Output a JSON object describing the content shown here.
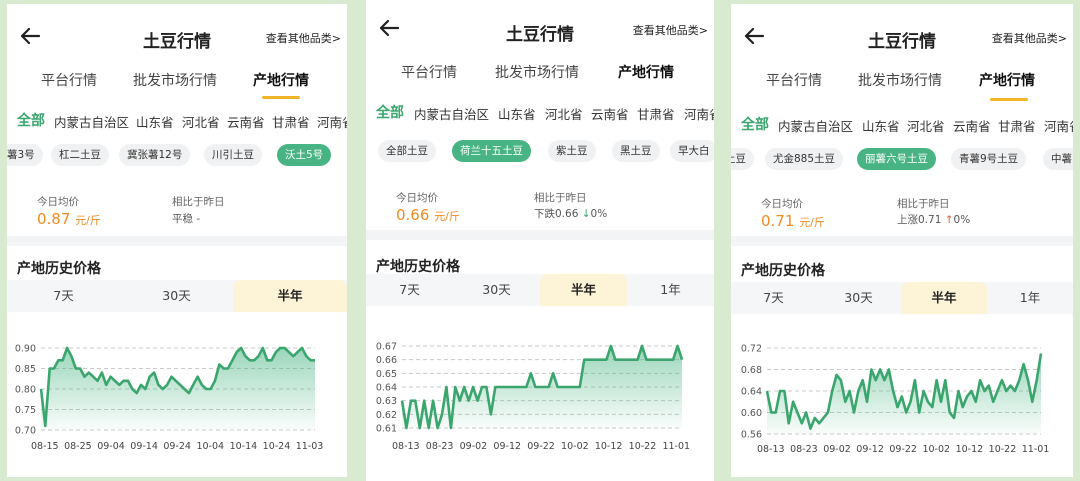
{
  "panels": [
    {
      "title": "土豆行情",
      "others_link": "查看其他品类>",
      "tabs": [
        "平台行情",
        "批发市场行情",
        "产地行情"
      ],
      "active_tab": 2,
      "regions": [
        "全部",
        "内蒙古自治区",
        "山东省",
        "河北省",
        "云南省",
        "甘肃省",
        "河南省"
      ],
      "active_region": 0,
      "varieties": [
        "薯3号",
        "杠二土豆",
        "冀张薯12号",
        "川引土豆",
        "沃土5号"
      ],
      "active_variety": 4,
      "price": {
        "today_label": "今日均价",
        "value": "0.87",
        "unit": "元/斤",
        "compare_label": "相比于昨日",
        "change_text": "平稳 -",
        "change_dir": "none"
      },
      "section_title": "产地历史价格",
      "ranges": [
        "7天",
        "30天",
        "半年"
      ],
      "active_range": 2,
      "chart_data": {
        "type": "area",
        "ylim": [
          0.7,
          0.9
        ],
        "yticks": [
          "0.70",
          "0.75",
          "0.80",
          "0.85",
          "0.90"
        ],
        "xticks": [
          "08-15",
          "08-25",
          "09-04",
          "09-14",
          "09-24",
          "10-04",
          "10-14",
          "10-24",
          "11-03"
        ],
        "values": [
          0.8,
          0.71,
          0.85,
          0.85,
          0.87,
          0.87,
          0.9,
          0.88,
          0.85,
          0.85,
          0.83,
          0.84,
          0.83,
          0.82,
          0.84,
          0.81,
          0.83,
          0.82,
          0.81,
          0.82,
          0.82,
          0.8,
          0.79,
          0.81,
          0.8,
          0.83,
          0.84,
          0.81,
          0.8,
          0.81,
          0.83,
          0.82,
          0.81,
          0.8,
          0.79,
          0.81,
          0.83,
          0.81,
          0.8,
          0.8,
          0.82,
          0.86,
          0.85,
          0.85,
          0.87,
          0.89,
          0.9,
          0.88,
          0.87,
          0.87,
          0.88,
          0.9,
          0.87,
          0.87,
          0.89,
          0.9,
          0.9,
          0.89,
          0.88,
          0.89,
          0.9,
          0.88,
          0.87,
          0.87
        ]
      }
    },
    {
      "title": "土豆行情",
      "others_link": "查看其他品类>",
      "tabs": [
        "平台行情",
        "批发市场行情",
        "产地行情"
      ],
      "active_tab": 2,
      "regions": [
        "全部",
        "内蒙古自治区",
        "山东省",
        "河北省",
        "云南省",
        "甘肃省",
        "河南省"
      ],
      "active_region": 0,
      "varieties": [
        "全部土豆",
        "荷兰十五土豆",
        "紫土豆",
        "黑土豆",
        "早大白"
      ],
      "active_variety": 1,
      "price": {
        "today_label": "今日均价",
        "value": "0.66",
        "unit": "元/斤",
        "compare_label": "相比于昨日",
        "change_text": "下跌0.66",
        "change_arrow": "↓",
        "change_pct": "0%",
        "change_dir": "down"
      },
      "section_title": "产地历史价格",
      "ranges": [
        "7天",
        "30天",
        "半年",
        "1年"
      ],
      "active_range": 2,
      "chart_data": {
        "type": "area",
        "ylim": [
          0.61,
          0.67
        ],
        "yticks": [
          "0.61",
          "0.62",
          "0.63",
          "0.64",
          "0.65",
          "0.66",
          "0.67"
        ],
        "xticks": [
          "08-13",
          "08-23",
          "09-02",
          "09-12",
          "09-22",
          "10-02",
          "10-12",
          "10-22",
          "11-01"
        ],
        "values": [
          0.63,
          0.61,
          0.63,
          0.63,
          0.61,
          0.63,
          0.61,
          0.63,
          0.61,
          0.62,
          0.64,
          0.61,
          0.64,
          0.63,
          0.64,
          0.63,
          0.64,
          0.63,
          0.64,
          0.64,
          0.62,
          0.64,
          0.64,
          0.64,
          0.64,
          0.64,
          0.64,
          0.64,
          0.64,
          0.65,
          0.64,
          0.64,
          0.64,
          0.64,
          0.65,
          0.64,
          0.64,
          0.64,
          0.64,
          0.64,
          0.64,
          0.66,
          0.66,
          0.66,
          0.66,
          0.66,
          0.66,
          0.67,
          0.66,
          0.66,
          0.66,
          0.66,
          0.66,
          0.66,
          0.67,
          0.66,
          0.66,
          0.66,
          0.66,
          0.66,
          0.66,
          0.66,
          0.67,
          0.66
        ]
      }
    },
    {
      "title": "土豆行情",
      "others_link": "查看其他品类>",
      "tabs": [
        "平台行情",
        "批发市场行情",
        "产地行情"
      ],
      "active_tab": 2,
      "regions": [
        "全部",
        "内蒙古自治区",
        "山东省",
        "河北省",
        "云南省",
        "甘肃省",
        "河南省"
      ],
      "active_region": 0,
      "varieties": [
        "土豆",
        "尤金885土豆",
        "丽薯六号土豆",
        "青薯9号土豆",
        "中薯"
      ],
      "active_variety": 2,
      "price": {
        "today_label": "今日均价",
        "value": "0.71",
        "unit": "元/斤",
        "compare_label": "相比于昨日",
        "change_text": "上涨0.71",
        "change_arrow": "↑",
        "change_pct": "0%",
        "change_dir": "up"
      },
      "section_title": "产地历史价格",
      "ranges": [
        "7天",
        "30天",
        "半年",
        "1年"
      ],
      "active_range": 2,
      "chart_data": {
        "type": "area",
        "ylim": [
          0.56,
          0.72
        ],
        "yticks": [
          "0.56",
          "0.60",
          "0.64",
          "0.68",
          "0.72"
        ],
        "xticks": [
          "08-13",
          "08-23",
          "09-02",
          "09-12",
          "09-22",
          "10-02",
          "10-12",
          "10-22",
          "11-01"
        ],
        "values": [
          0.64,
          0.6,
          0.6,
          0.64,
          0.64,
          0.58,
          0.62,
          0.6,
          0.58,
          0.6,
          0.57,
          0.59,
          0.58,
          0.59,
          0.6,
          0.64,
          0.67,
          0.66,
          0.62,
          0.64,
          0.6,
          0.64,
          0.66,
          0.62,
          0.68,
          0.66,
          0.68,
          0.66,
          0.68,
          0.64,
          0.61,
          0.63,
          0.6,
          0.62,
          0.66,
          0.6,
          0.64,
          0.62,
          0.61,
          0.66,
          0.62,
          0.66,
          0.6,
          0.59,
          0.64,
          0.61,
          0.63,
          0.64,
          0.62,
          0.66,
          0.64,
          0.65,
          0.62,
          0.64,
          0.66,
          0.64,
          0.65,
          0.64,
          0.66,
          0.69,
          0.66,
          0.62,
          0.66,
          0.71
        ]
      }
    }
  ]
}
